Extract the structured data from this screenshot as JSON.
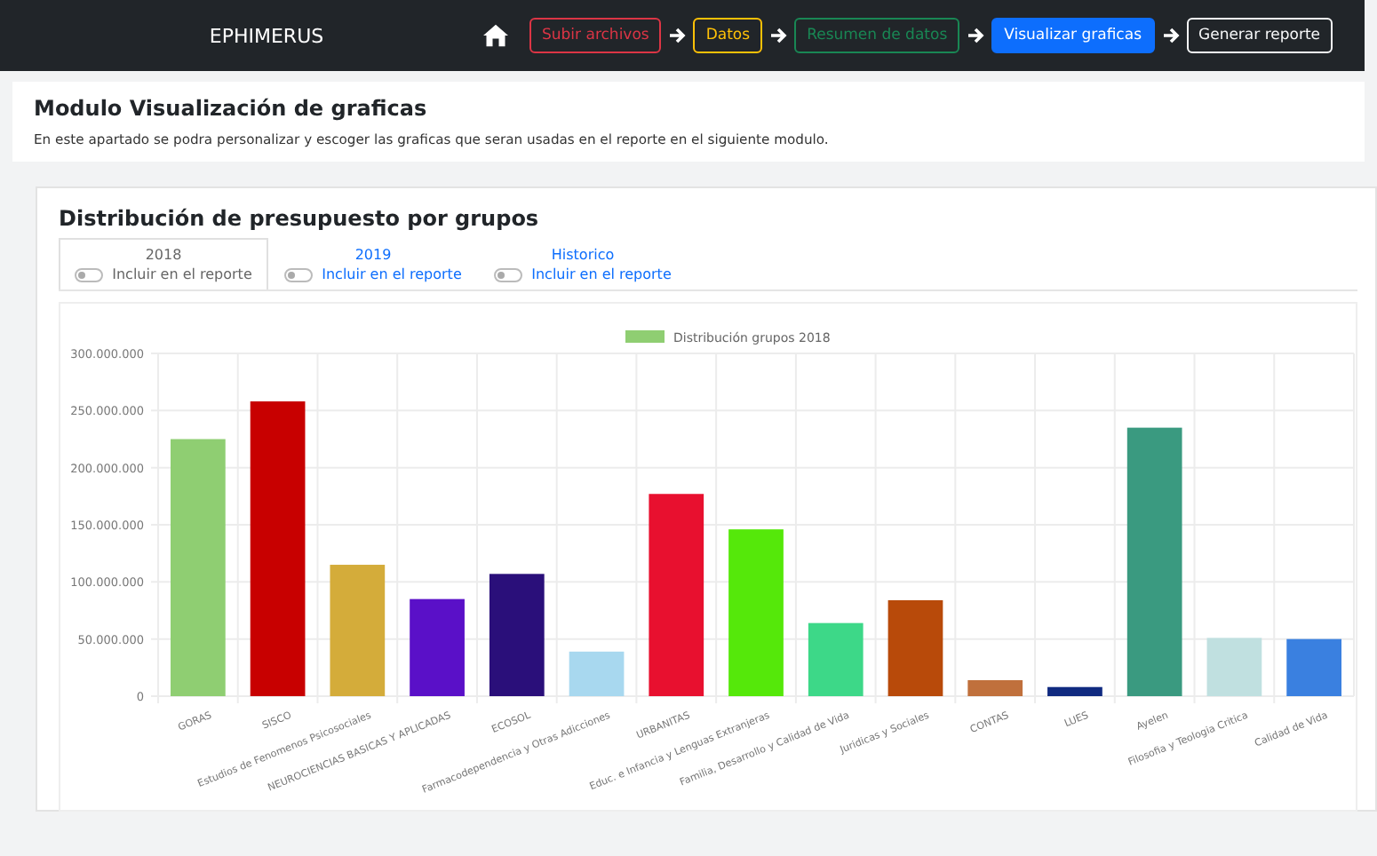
{
  "navbar": {
    "brand": "EPHIMERUS",
    "steps": [
      {
        "label": "Subir archivos",
        "color": "#dc3545",
        "selected": false
      },
      {
        "label": "Datos",
        "color": "#ffc107",
        "selected": false
      },
      {
        "label": "Resumen de datos",
        "color": "#198754",
        "selected": false
      },
      {
        "label": "Visualizar graficas",
        "color": "#0d6efd",
        "selected": true
      },
      {
        "label": "Generar reporte",
        "color": "#f8f9fa",
        "selected": false
      }
    ]
  },
  "header": {
    "title": "Modulo Visualización de graficas",
    "description": "En este apartado se podra personalizar y escoger las graficas que seran usadas en el reporte en el siguiente modulo."
  },
  "card": {
    "title": "Distribución de presupuesto por grupos",
    "tabs": [
      {
        "label": "2018",
        "selected": true,
        "toggle": {
          "label": "Incluir en el reporte",
          "checked": false
        }
      },
      {
        "label": "2019",
        "selected": false,
        "toggle": {
          "label": "Incluir en el reporte",
          "checked": false
        }
      },
      {
        "label": "Historico",
        "selected": false,
        "toggle": {
          "label": "Incluir en el reporte",
          "checked": false
        }
      }
    ],
    "chart_data": {
      "type": "bar",
      "categories": [
        "GORAS",
        "SISCO",
        "Estudios de Fenomenos Psicosociales",
        "NEUROCIENCIAS BASICAS Y APLICADAS",
        "ECOSOL",
        "Farmacodependencia y Otras Adicciones",
        "URBANITAS",
        "Educ. e Infancia y Lenguas Extranjeras",
        "Familia, Desarrollo y Calidad de Vida",
        "Juridicas y Sociales",
        "CONTAS",
        "LUES",
        "Ayelen",
        "Filosofia y Teologia Critica",
        "Calidad de Vida"
      ],
      "series": [
        {
          "name": "Distribución grupos 2018",
          "color": [
            "#8fce72",
            "#c80000",
            "#d4ac3a",
            "#5a10c8",
            "#2a0f7a",
            "#a8d8ef",
            "#e8102f",
            "#55e80a",
            "#3dd888",
            "#b84a0a",
            "#c0703c",
            "#102a80",
            "#3a9a80",
            "#c0e0e0",
            "#3a80e0"
          ],
          "values": [
            225000000,
            258000000,
            115000000,
            85000000,
            107000000,
            39000000,
            177000000,
            146000000,
            64000000,
            84000000,
            14000000,
            8000000,
            235000000,
            51000000,
            50000000
          ]
        }
      ],
      "grid": true,
      "ylim": [
        0,
        300000000
      ],
      "yticks": [
        {
          "value": 0,
          "label": "0"
        },
        {
          "value": 50000000,
          "label": "50.000.000"
        },
        {
          "value": 100000000,
          "label": "100.000.000"
        },
        {
          "value": 150000000,
          "label": "150.000.000"
        },
        {
          "value": 200000000,
          "label": "200.000.000"
        },
        {
          "value": 250000000,
          "label": "250.000.000"
        },
        {
          "value": 300000000,
          "label": "300.000.000"
        }
      ]
    }
  }
}
